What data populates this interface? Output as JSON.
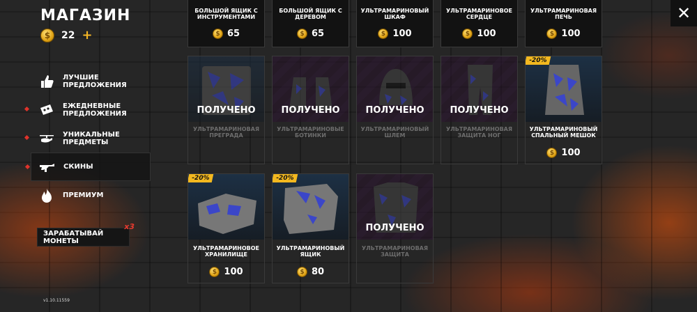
{
  "header": {
    "title": "МАГАЗИН",
    "coins": "22",
    "plus": "+"
  },
  "nav": [
    {
      "label": "ЛУЧШИЕ\nПРЕДЛОЖЕНИЯ",
      "icon": "thumbs-up-icon"
    },
    {
      "label": "ЕЖЕДНЕВНЫЕ\nПРЕДЛОЖЕНИЯ",
      "icon": "ticket-icon"
    },
    {
      "label": "УНИКАЛЬНЫЕ\nПРЕДМЕТЫ",
      "icon": "helicopter-icon"
    },
    {
      "label": "СКИНЫ",
      "icon": "rifle-icon"
    },
    {
      "label": "ПРЕМИУМ",
      "icon": "flame-icon"
    }
  ],
  "earn": {
    "label": "ЗАРАБАТЫВАЙ МОНЕТЫ",
    "multiplier": "x3"
  },
  "version": "v1.10.11559",
  "close": "✕",
  "owned_label": "ПОЛУЧЕНО",
  "items": [
    {
      "name": "БОЛЬШОЙ ЯЩИК С\nИНСТРУМЕНТАМИ",
      "price": "65"
    },
    {
      "name": "БОЛЬШОЙ ЯЩИК С\nДЕРЕВОМ",
      "price": "65"
    },
    {
      "name": "УЛЬТРАМАРИНОВЫЙ\nШКАФ",
      "price": "100"
    },
    {
      "name": "УЛЬТРАМАРИНОВОЕ\nСЕРДЦЕ",
      "price": "100"
    },
    {
      "name": "УЛЬТРАМАРИНОВАЯ\nПЕЧЬ",
      "price": "100"
    },
    {
      "name": "УЛЬТРАМАРИНОВАЯ\nПРЕГРАДА",
      "owned": true
    },
    {
      "name": "УЛЬТРАМАРИНОВЫЕ\nБОТИНКИ",
      "owned": true
    },
    {
      "name": "УЛЬТРАМАРИНОВЫЙ\nШЛЕМ",
      "owned": true
    },
    {
      "name": "УЛЬТРАМАРИНОВАЯ\nЗАЩИТА НОГ",
      "owned": true
    },
    {
      "name": "УЛЬТРАМАРИНОВЫЙ\nСПАЛЬНЫЙ МЕШОК",
      "price": "100",
      "discount": "-20%"
    },
    {
      "name": "УЛЬТРАМАРИНОВОЕ\nХРАНИЛИЩЕ",
      "price": "100",
      "discount": "-20%"
    },
    {
      "name": "УЛЬТРАМАРИНОВЫЙ\nЯЩИК",
      "price": "80",
      "discount": "-20%"
    },
    {
      "name": "УЛЬТРАМАРИНОВАЯ\nЗАЩИТА",
      "owned": true
    }
  ]
}
